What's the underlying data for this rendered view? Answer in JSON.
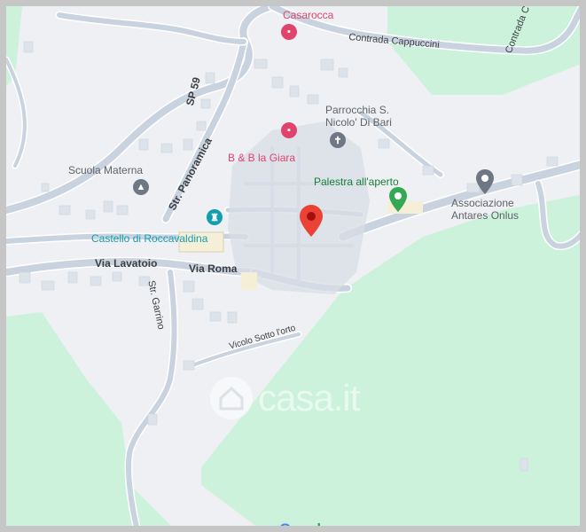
{
  "map": {
    "places": {
      "casarocca": "Casarocca",
      "contrada_cappuccini": "Contrada Cappuccini",
      "contrada_cappuccini_2": "Contrada C",
      "sp59": "SP 59",
      "parrocchia_line1": "Parrocchia S.",
      "parrocchia_line2": "Nicolo' Di Bari",
      "scuola_materna": "Scuola Materna",
      "bb_la_giara": "B & B la Giara",
      "str_panoramica": "Str. Panoramica",
      "palestra": "Palestra all'aperto",
      "associazione_line1": "Associazione",
      "associazione_line2": "Antares Onlus",
      "castello": "Castello di Roccavaldina",
      "via_lavatoio": "Via Lavatoio",
      "via_roma": "Via Roma",
      "str_garrino": "Str. Garrino",
      "vicolo_sotto_orto": "Vicolo Sotto l'orto"
    },
    "icons": {
      "casarocca": "hotel-icon",
      "bb_la_giara": "hotel-icon",
      "parrocchia": "church-icon",
      "scuola_materna": "school-icon",
      "castello": "castle-icon",
      "palestra": "park-pin-icon",
      "associazione": "place-pin-icon",
      "selected": "location-pin-icon"
    },
    "colors": {
      "land": "#eef0f3",
      "green_area": "#cdf2dc",
      "road": "#c9d3df",
      "road_outline": "#ffffff",
      "poi_red": "#e0446d",
      "poi_teal": "#129eaf",
      "poi_green": "#188038",
      "selected_pin": "#ea4335"
    },
    "watermark": "casa.it",
    "attribution": [
      "G",
      "o",
      "o",
      "g",
      "l",
      "e"
    ]
  }
}
